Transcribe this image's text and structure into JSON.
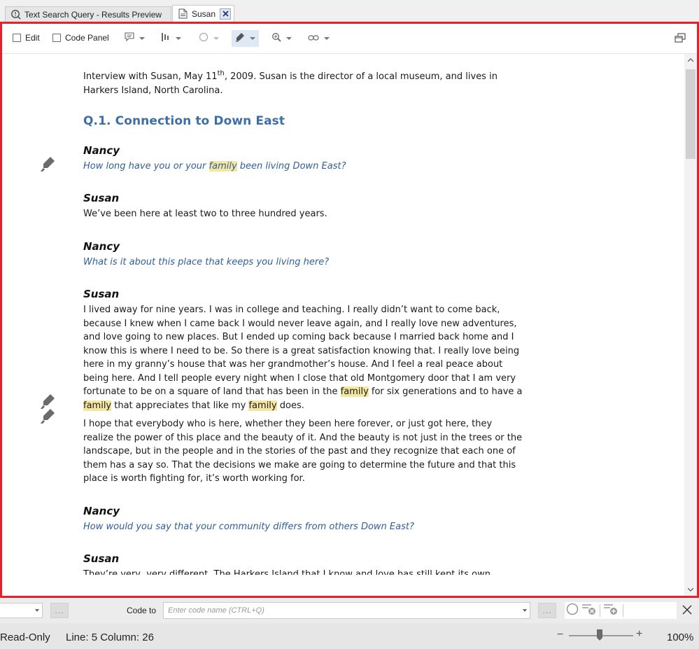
{
  "tabs": [
    {
      "label": "Text Search Query - Results Preview",
      "icon": "search-query-icon"
    },
    {
      "label": "Susan",
      "icon": "document-icon",
      "close_icon": "close-icon"
    }
  ],
  "toolbar": {
    "edit_label": "Edit",
    "code_panel_label": "Code Panel",
    "buttons": [
      "annotations-icon",
      "coding-stripes-icon",
      "circle-icon",
      "highlight-icon",
      "zoom-icon",
      "link-icon"
    ],
    "restore_icon": "restore-window-icon"
  },
  "document": {
    "intro_pre": "Interview with Susan, May 11",
    "intro_sup": "th",
    "intro_post": ", 2009.  Susan is the director of a local museum, and lives in Harkers Island, North Carolina.",
    "heading": "Q.1. Connection to Down East",
    "blocks": [
      {
        "speaker": "Nancy",
        "q_pre": "How long have you or your ",
        "q_hl": "family",
        "q_post": " been living Down East?"
      },
      {
        "speaker": "Susan",
        "text": "We’ve been here at least two to three hundred years."
      },
      {
        "speaker": "Nancy",
        "question": "What is it about this place that keeps you living here?"
      },
      {
        "speaker": "Susan",
        "p1_a": "I lived away for nine years. I was in college and teaching. I really didn’t want to come back, because I knew when I came back I would never leave again, and I really love new adventures, and love going to new places. But I ended up coming back because I married back home and I know this is where I need to be. So there is a great satisfaction knowing that. I really love being here in my granny’s house that was her grandmother’s house. And I feel a real peace about being here. And I tell people every night when I close that old Montgomery door that I am very fortunate to be on a square of land that has been in the ",
        "p1_hl1": "family",
        "p1_b": " for six generations and to have a ",
        "p1_hl2": "family",
        "p1_c": " that appreciates that like my ",
        "p1_hl3": "family",
        "p1_d": " does.",
        "p2": "I hope that everybody who is here, whether they been here forever, or just got here, they realize the power of this place and the beauty of it. And the beauty is not just in the trees or the landscape, but in the people and in the stories of the past and they recognize that each one of them has a say so. That the decisions we make are going to determine the future and that this place is worth fighting for, it’s worth working for."
      },
      {
        "speaker": "Nancy",
        "question": "How would you say that your community differs from others Down East?"
      },
      {
        "speaker": "Susan",
        "cut_text": "They’re very, very different. The Harkers Island that I know and love has still kept its own"
      }
    ],
    "marker_icon": "coding-marker-icon"
  },
  "codebar": {
    "code_to_label": "Code to",
    "code_placeholder": "Enter code name (CTRL+Q)",
    "more_button": "...",
    "icons": [
      "uncode-icon",
      "remove-code-icon",
      "add-code-icon"
    ]
  },
  "status": {
    "mode": "Read-Only",
    "position": "Line: 5 Column: 26",
    "zoom_minus": "−",
    "zoom_plus": "+",
    "zoom": "100%",
    "zoom_level": 0.45
  },
  "colors": {
    "accent_red": "#e8202a",
    "heading_blue": "#3c6fa8",
    "question_blue": "#2f5f99",
    "highlight": "#f4e7a1"
  }
}
